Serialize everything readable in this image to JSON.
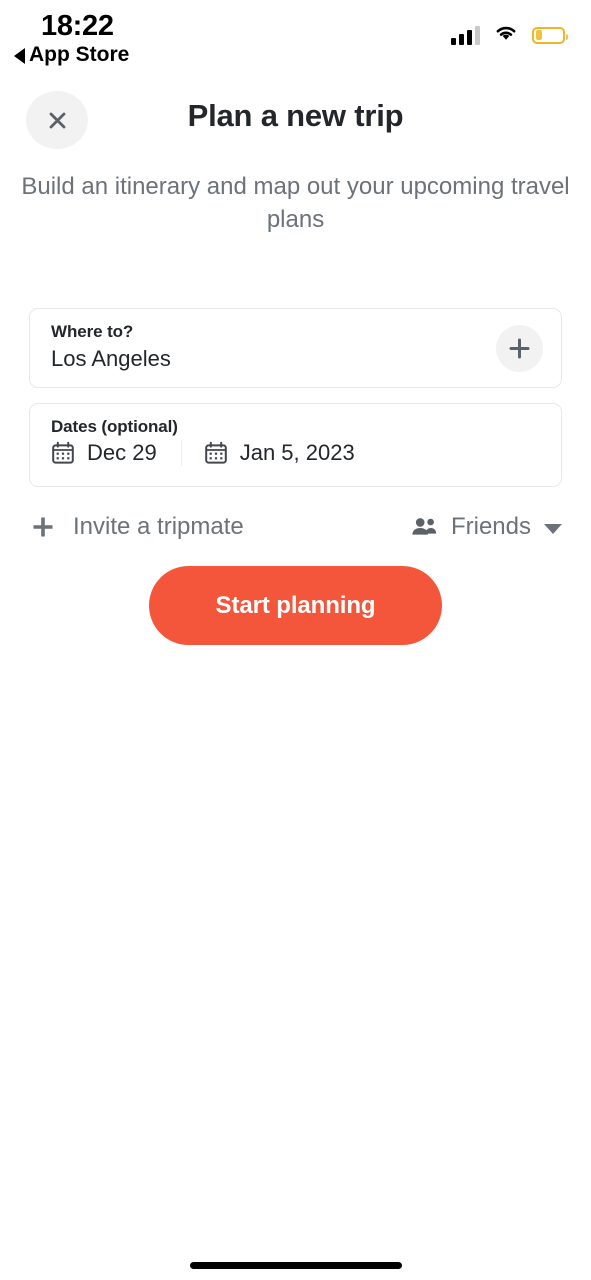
{
  "status_bar": {
    "time": "18:22",
    "back_label": "App Store",
    "icons": {
      "signal": "signal-bars-icon",
      "wifi": "wifi-icon",
      "battery": "battery-low-icon"
    }
  },
  "header": {
    "close_icon": "close-icon",
    "title": "Plan a new trip",
    "subtitle": "Build an itinerary and map out your upcoming travel plans"
  },
  "form": {
    "destination": {
      "label": "Where to?",
      "value": "Los Angeles",
      "add_icon": "plus-icon"
    },
    "dates": {
      "label": "Dates (optional)",
      "start": {
        "value": "Dec 29",
        "icon": "calendar-icon"
      },
      "end": {
        "value": "Jan 5, 2023",
        "icon": "calendar-icon"
      }
    },
    "invite": {
      "icon": "plus-icon",
      "label": "Invite a tripmate"
    },
    "visibility": {
      "icon": "people-icon",
      "value": "Friends",
      "chevron": "chevron-down-icon"
    }
  },
  "cta": {
    "label": "Start planning"
  },
  "colors": {
    "accent": "#F4563C",
    "text_primary": "#23272B",
    "text_secondary": "#6C7279",
    "card_border": "#E7E8EA",
    "chip_background": "#F2F2F3",
    "battery_warning": "#F0B429"
  }
}
